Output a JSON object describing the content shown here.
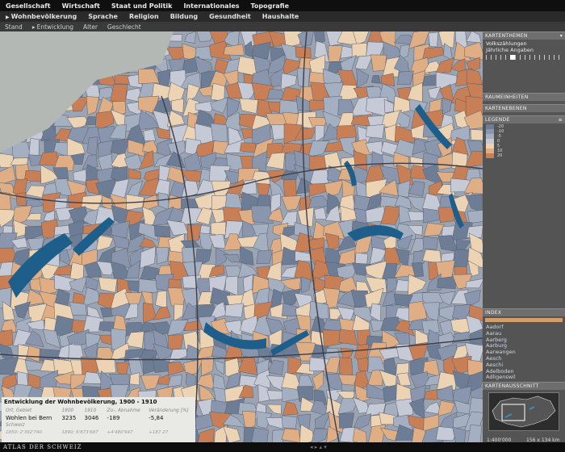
{
  "nav": {
    "primary": [
      "Gesellschaft",
      "Wirtschaft",
      "Staat und Politik",
      "Internationales",
      "Topografie"
    ],
    "secondary": [
      "Wohnbevölkerung",
      "Sprache",
      "Religion",
      "Bildung",
      "Gesundheit",
      "Haushalte"
    ],
    "tertiary": [
      "Stand",
      "Entwicklung",
      "Alter",
      "Geschlecht"
    ],
    "secondary_active": 0,
    "tertiary_active": 1
  },
  "panel": {
    "kartenthemen": "KARTENTHEMEN",
    "themes": [
      "Volkszählungen",
      "Jährliche Angaben"
    ],
    "raumeinheiten": "RAUMEINHEITEN",
    "kartenebenen": "KARTENEBENEN",
    "legende": "LEGENDE",
    "legend": [
      {
        "label": "-20",
        "color": "#6e7d96"
      },
      {
        "label": "-10",
        "color": "#8996ad"
      },
      {
        "label": "-5",
        "color": "#a5afc2"
      },
      {
        "label": "0",
        "color": "#c5cad6"
      },
      {
        "label": "5",
        "color": "#ecd3b3"
      },
      {
        "label": "10",
        "color": "#dfae84"
      },
      {
        "label": "20",
        "color": "#c97f55"
      }
    ],
    "index_title": "INDEX",
    "index_items": [
      "Aadorf",
      "Aarau",
      "Aarberg",
      "Aarburg",
      "Aarwangen",
      "Aesch",
      "Aeschi",
      "Adelboden",
      "Adligenswil"
    ],
    "kartenausschnitt": "KARTENAUSSCHNITT",
    "scale": "1:400'000",
    "dims": "156 x 134 km"
  },
  "info": {
    "title": "Entwicklung der Wohnbevölkerung, 1900 - 1910",
    "headers": [
      "Ort, Gebiet",
      "1900",
      "1910",
      "Zu-, Abnahme",
      "Veränderung [%]"
    ],
    "row": [
      "Wohlen bei Bern",
      "3235",
      "3046",
      "-189",
      "-5,84"
    ],
    "ref_label": "Schweiz",
    "ref": [
      "1850: 2'392'740",
      "1890: 6'873'687",
      "+4'480'947",
      "+187.27"
    ]
  },
  "brand": "ATLAS DER SCHWEIZ",
  "colors": {
    "accent": "#d59d6a",
    "water": "#1d5f8a"
  }
}
